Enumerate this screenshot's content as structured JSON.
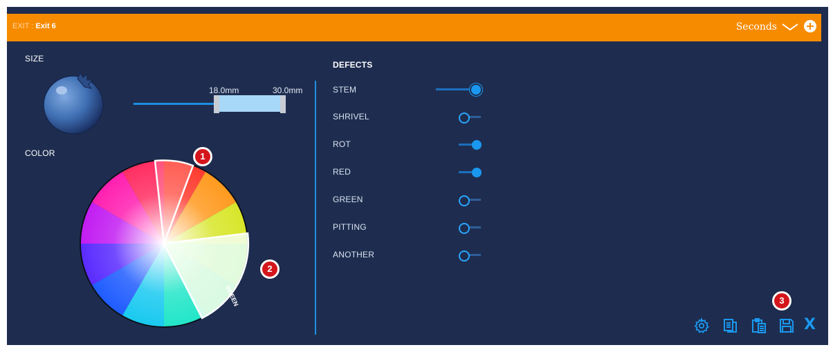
{
  "header": {
    "breadcrumb_root": "EXIT",
    "breadcrumb_separator": ":",
    "exit_name": "Exit 6",
    "unit_label": "Seconds",
    "bar_color": "#f78b00"
  },
  "size": {
    "heading": "SIZE",
    "min_label": "18.0mm",
    "max_label": "30.0mm"
  },
  "color": {
    "heading": "COLOR",
    "wheel_label": "GREEN"
  },
  "defects": {
    "heading": "DEFECTS",
    "items": [
      {
        "label": "STEM",
        "on": true
      },
      {
        "label": "SHRIVEL",
        "on": false
      },
      {
        "label": "ROT",
        "on": true
      },
      {
        "label": "RED",
        "on": true
      },
      {
        "label": "GREEN",
        "on": false
      },
      {
        "label": "PITTING",
        "on": false
      },
      {
        "label": "ANOTHER",
        "on": false
      }
    ]
  },
  "annotations": [
    "1",
    "2",
    "3"
  ],
  "toolbar": {
    "icons": [
      "settings-icon",
      "copy-icon",
      "paste-icon",
      "save-icon",
      "close-icon"
    ],
    "close_label": "X"
  }
}
